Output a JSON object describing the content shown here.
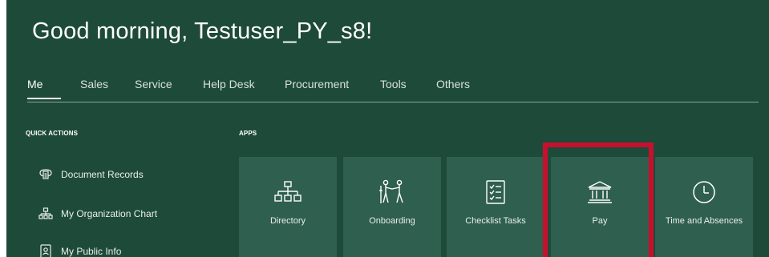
{
  "greeting": "Good morning, Testuser_PY_s8!",
  "nav": {
    "tabs": [
      {
        "label": "Me",
        "active": true
      },
      {
        "label": "Sales"
      },
      {
        "label": "Service"
      },
      {
        "label": "Help Desk"
      },
      {
        "label": "Procurement"
      },
      {
        "label": "Tools"
      },
      {
        "label": "Others"
      }
    ]
  },
  "quick_actions": {
    "heading": "QUICK ACTIONS",
    "items": [
      {
        "label": "Document Records",
        "icon": "document-records-icon"
      },
      {
        "label": "My Organization Chart",
        "icon": "org-chart-icon"
      },
      {
        "label": "My Public Info",
        "icon": "id-badge-icon"
      }
    ]
  },
  "apps": {
    "heading": "APPS",
    "tiles": [
      {
        "label": "Directory",
        "icon": "directory-icon"
      },
      {
        "label": "Onboarding",
        "icon": "onboarding-icon"
      },
      {
        "label": "Checklist Tasks",
        "icon": "checklist-icon"
      },
      {
        "label": "Pay",
        "icon": "bank-icon"
      },
      {
        "label": "Time and Absences",
        "icon": "clock-icon"
      }
    ]
  },
  "colors": {
    "background": "#1e4a3a",
    "tile": "#2f5f4e",
    "highlight": "#c8102e"
  }
}
